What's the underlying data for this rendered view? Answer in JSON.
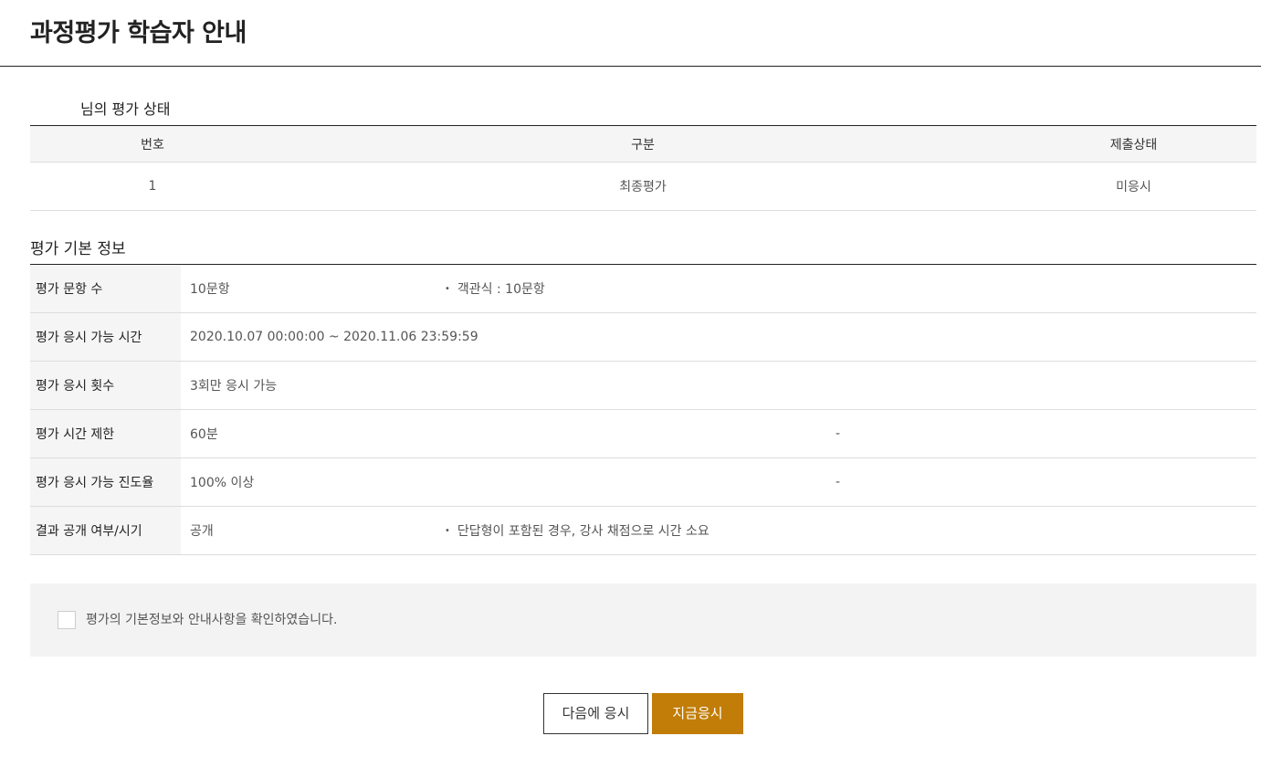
{
  "page_title": "과정평가 학습자 안내",
  "status": {
    "caption": "님의 평가 상태",
    "headers": [
      "번호",
      "구분",
      "제출상태"
    ],
    "rows": [
      [
        "1",
        "최종평가",
        "미응시"
      ]
    ]
  },
  "info": {
    "heading": "평가 기본 정보",
    "rows": [
      {
        "label": "평가 문항 수",
        "value": "10문항",
        "bullet": "•",
        "note": "객관식 : 10문항"
      },
      {
        "label": "평가 응시 가능 시간",
        "value": "2020.10.07 00:00:00 ~ 2020.11.06 23:59:59",
        "note": ""
      },
      {
        "label": "평가 응시 횟수",
        "value": "3회만 응시 가능",
        "note": ""
      },
      {
        "label": "평가 시간 제한",
        "value": "60분",
        "note": "-"
      },
      {
        "label": "평가 응시 가능 진도율",
        "value": "100% 이상",
        "note": "-"
      },
      {
        "label": "결과 공개 여부/시기",
        "value": "공개",
        "bullet": "•",
        "note": "단답형이 포함된 경우, 강사 채점으로 시간 소요"
      }
    ]
  },
  "confirm": {
    "label": "평가의 기본정보와 안내사항을 확인하였습니다.",
    "checked": false
  },
  "buttons": {
    "later": "다음에 응시",
    "now": "지금응시"
  },
  "colors": {
    "accent": "#c17d07",
    "header_bg": "#f5f5f5"
  }
}
